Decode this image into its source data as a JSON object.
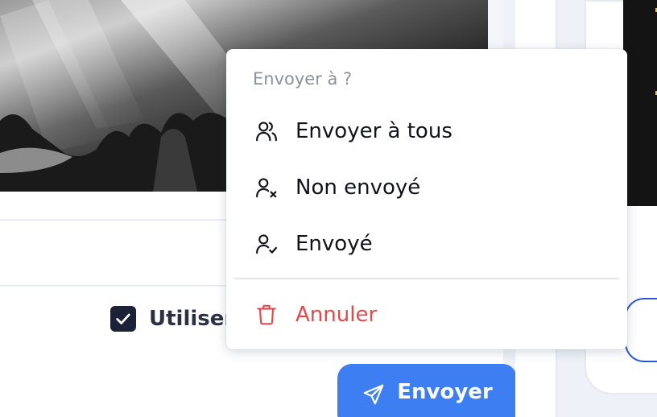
{
  "background": {
    "use_checkbox_label": "Utiliser",
    "use_checkbox_checked": true,
    "send_button_label": "Envoyer",
    "accent_color": "#3d7ff2"
  },
  "menu": {
    "header": "Envoyer à ?",
    "items": [
      {
        "label": "Envoyer à tous",
        "icon": "users-icon"
      },
      {
        "label": "Non envoyé",
        "icon": "user-x-icon"
      },
      {
        "label": "Envoyé",
        "icon": "user-check-icon"
      }
    ],
    "cancel": {
      "label": "Annuler",
      "icon": "trash-icon",
      "color": "#e24b4b"
    }
  }
}
